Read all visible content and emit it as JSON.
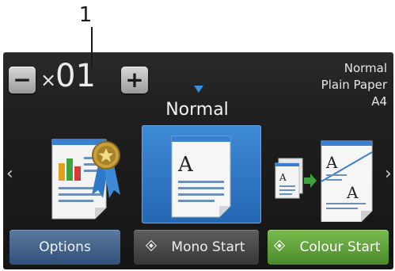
{
  "callout": {
    "number": "1"
  },
  "copies": {
    "minus_label": "−",
    "plus_label": "+",
    "times_symbol": "×",
    "count": "01"
  },
  "settings_summary": {
    "quality": "Normal",
    "paper_type": "Plain Paper",
    "paper_size": "A4"
  },
  "mode": {
    "title": "Normal"
  },
  "carousel": {
    "left_arrow": "‹",
    "right_arrow": "›",
    "presets": [
      {
        "icon": "quality-award-document-icon",
        "selected": false
      },
      {
        "icon": "normal-document-icon",
        "selected": true
      },
      {
        "icon": "two-in-one-copy-icon",
        "selected": false
      }
    ]
  },
  "buttons": {
    "options": "Options",
    "mono_start": "Mono Start",
    "colour_start": "Colour Start"
  },
  "colors": {
    "screen_bg": "#1f1f1f",
    "selected": "#2f74c0",
    "options_button": "#3f628c",
    "mono_button": "#474747",
    "colour_button": "#5fa03a"
  }
}
